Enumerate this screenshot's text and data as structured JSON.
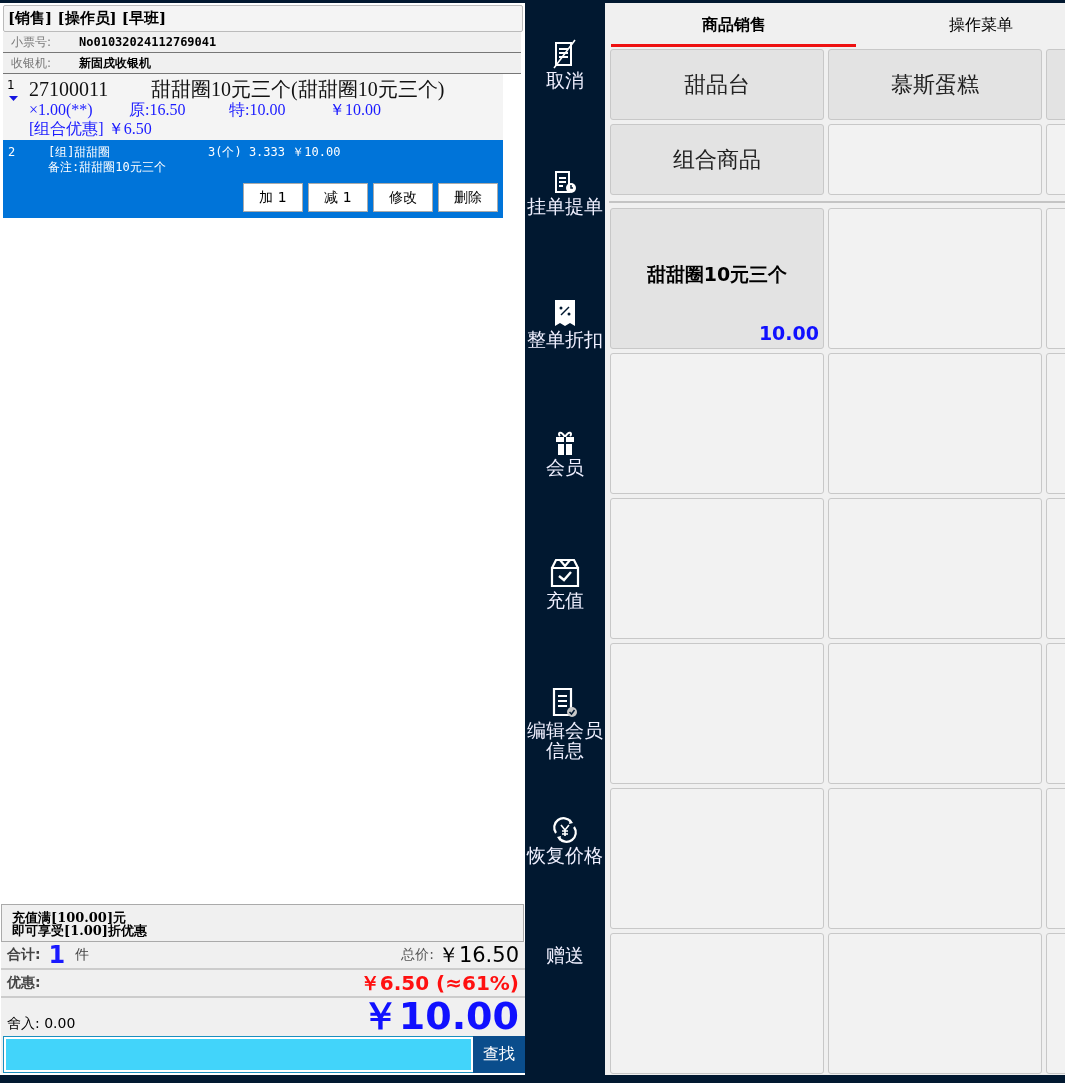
{
  "header": {
    "title": "[销售] [操作员] [早班]",
    "ticket_label": "小票号:",
    "ticket_no": "No01032024112769041",
    "register_label": "收银机:",
    "register_name": "新固戌收银机"
  },
  "items": [
    {
      "index": "1",
      "code": "27100011",
      "name": "甜甜圈10元三个(甜甜圈10元三个)",
      "qty": "×1.00(**)",
      "original": "原:16.50",
      "special": "特:10.00",
      "amount": "￥10.00",
      "promo": "[组合优惠] ￥6.50",
      "selected": false
    },
    {
      "index": "2",
      "name": "[组]甜甜圈",
      "qty": "3(个) 3.333 ￥10.00",
      "note": "备注:甜甜圈10元三个",
      "selected": true
    }
  ],
  "item_actions": [
    "加 1",
    "减 1",
    "修改",
    "删除"
  ],
  "promo": [
    "充值满[100.00]元",
    "即可享受[1.00]折优惠"
  ],
  "totals": {
    "count_label": "合计:",
    "count": "1",
    "unit": "件",
    "total_label": "总价:",
    "total": "￥16.50",
    "discount_label": "优惠:",
    "discount": "￥6.50 (≈61%)",
    "rounding": "舍入: 0.00",
    "payable": "￥10.00"
  },
  "search": {
    "button": "查找"
  },
  "sidebar": [
    {
      "kind": "cancel",
      "label": "取消"
    },
    {
      "kind": "hold",
      "label": "挂单提单"
    },
    {
      "kind": "discount",
      "label": "整单折扣"
    },
    {
      "kind": "member",
      "label": "会员"
    },
    {
      "kind": "recharge",
      "label": "充值"
    },
    {
      "kind": "edit",
      "label": "编辑会员信息"
    },
    {
      "kind": "restore",
      "label": "恢复价格"
    },
    {
      "kind": "gift",
      "label": "赠送"
    }
  ],
  "tabs": [
    {
      "label": "商品销售",
      "selected": true
    },
    {
      "label": "操作菜单",
      "selected": false
    }
  ],
  "categories": [
    {
      "kind": "category",
      "label": "甜品台"
    },
    {
      "kind": "category",
      "label": "慕斯蛋糕"
    },
    {
      "kind": "category"
    },
    {
      "kind": "category",
      "label": "组合商品"
    },
    {
      "kind": "empty"
    },
    {
      "kind": "empty"
    }
  ],
  "products": [
    {
      "kind": "product",
      "name": "甜甜圈10元三个",
      "price": "10.00"
    },
    {
      "kind": "empty"
    },
    {
      "kind": "empty"
    },
    {
      "kind": "empty"
    },
    {
      "kind": "empty"
    },
    {
      "kind": "empty"
    },
    {
      "kind": "empty"
    },
    {
      "kind": "empty"
    },
    {
      "kind": "empty"
    },
    {
      "kind": "empty"
    },
    {
      "kind": "empty"
    },
    {
      "kind": "empty"
    },
    {
      "kind": "empty"
    },
    {
      "kind": "empty"
    },
    {
      "kind": "empty"
    },
    {
      "kind": "empty"
    },
    {
      "kind": "empty"
    },
    {
      "kind": "empty"
    }
  ]
}
